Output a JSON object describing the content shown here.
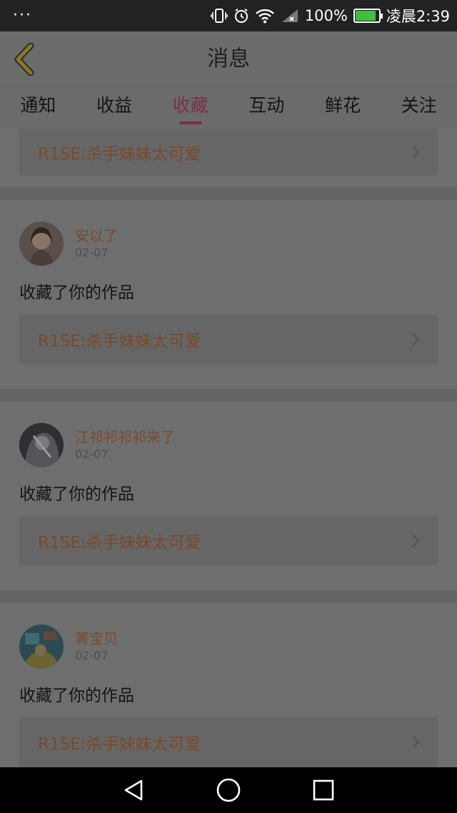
{
  "status_bar": {
    "dots": "···",
    "battery_percent": "100%",
    "time": "凌晨2:39",
    "battery_level": 0.9
  },
  "header": {
    "title": "消息",
    "back_icon": "chevron-left-icon"
  },
  "tabs": [
    {
      "label": "通知",
      "active": false
    },
    {
      "label": "收益",
      "active": false
    },
    {
      "label": "收藏",
      "active": true
    },
    {
      "label": "互动",
      "active": false
    },
    {
      "label": "鲜花",
      "active": false
    },
    {
      "label": "关注",
      "active": false
    }
  ],
  "feed": {
    "partial_top": {
      "work_title": "R1SE:杀手妹妹太可爱"
    },
    "items": [
      {
        "user": "安以了",
        "date": "02-07",
        "action": "收藏了你的作品",
        "work_title": "R1SE:杀手妹妹太可爱"
      },
      {
        "user": "江祁祁祁祁来了",
        "date": "02-07",
        "action": "收藏了你的作品",
        "work_title": "R1SE:杀手妹妹太可爱"
      },
      {
        "user": "菁宝贝",
        "date": "02-07",
        "action": "收藏了你的作品",
        "work_title": "R1SE:杀手妹妹太可爱"
      }
    ]
  },
  "nav_bar": {
    "back": "triangle-back-icon",
    "home": "circle-home-icon",
    "recents": "square-recents-icon"
  },
  "colors": {
    "overlay_bg": "#6e6e6e",
    "accent": "#7a2f4e",
    "link_text": "#7a4a2c",
    "back_chevron": "#8a7a1c"
  }
}
